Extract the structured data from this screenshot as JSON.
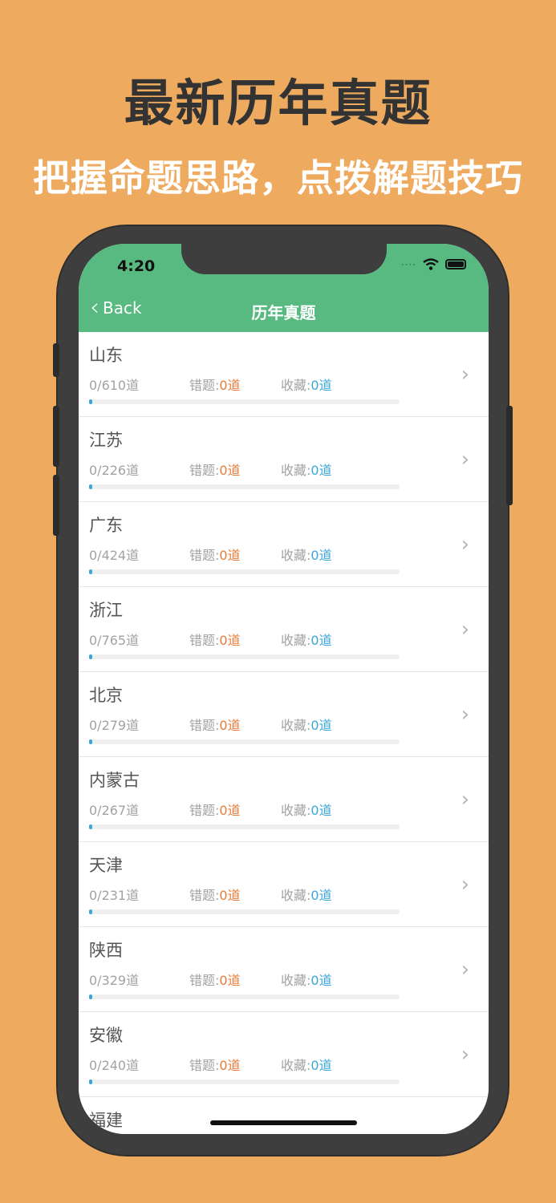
{
  "promo": {
    "title": "最新历年真题",
    "subtitle": "把握命题思路，点拨解题技巧"
  },
  "status_bar": {
    "time": "4:20",
    "signal_dots": "····"
  },
  "nav": {
    "back_label": "Back",
    "title": "历年真题"
  },
  "labels": {
    "wrong": "错题:",
    "fav": "收藏:"
  },
  "colors": {
    "background": "#EEAB5F",
    "header": "#58BA81",
    "wrong": "#E57C3A",
    "fav": "#3BA6D9"
  },
  "items": [
    {
      "name": "山东",
      "count": "0/610道",
      "wrong": "0道",
      "fav": "0道",
      "progress": 0.01
    },
    {
      "name": "江苏",
      "count": "0/226道",
      "wrong": "0道",
      "fav": "0道",
      "progress": 0.01
    },
    {
      "name": "广东",
      "count": "0/424道",
      "wrong": "0道",
      "fav": "0道",
      "progress": 0.01
    },
    {
      "name": "浙江",
      "count": "0/765道",
      "wrong": "0道",
      "fav": "0道",
      "progress": 0.01
    },
    {
      "name": "北京",
      "count": "0/279道",
      "wrong": "0道",
      "fav": "0道",
      "progress": 0.01
    },
    {
      "name": "内蒙古",
      "count": "0/267道",
      "wrong": "0道",
      "fav": "0道",
      "progress": 0.01
    },
    {
      "name": "天津",
      "count": "0/231道",
      "wrong": "0道",
      "fav": "0道",
      "progress": 0.01
    },
    {
      "name": "陕西",
      "count": "0/329道",
      "wrong": "0道",
      "fav": "0道",
      "progress": 0.01
    },
    {
      "name": "安徽",
      "count": "0/240道",
      "wrong": "0道",
      "fav": "0道",
      "progress": 0.01
    },
    {
      "name": "福建",
      "count": "",
      "wrong": "",
      "fav": "",
      "progress": 0.01
    }
  ]
}
